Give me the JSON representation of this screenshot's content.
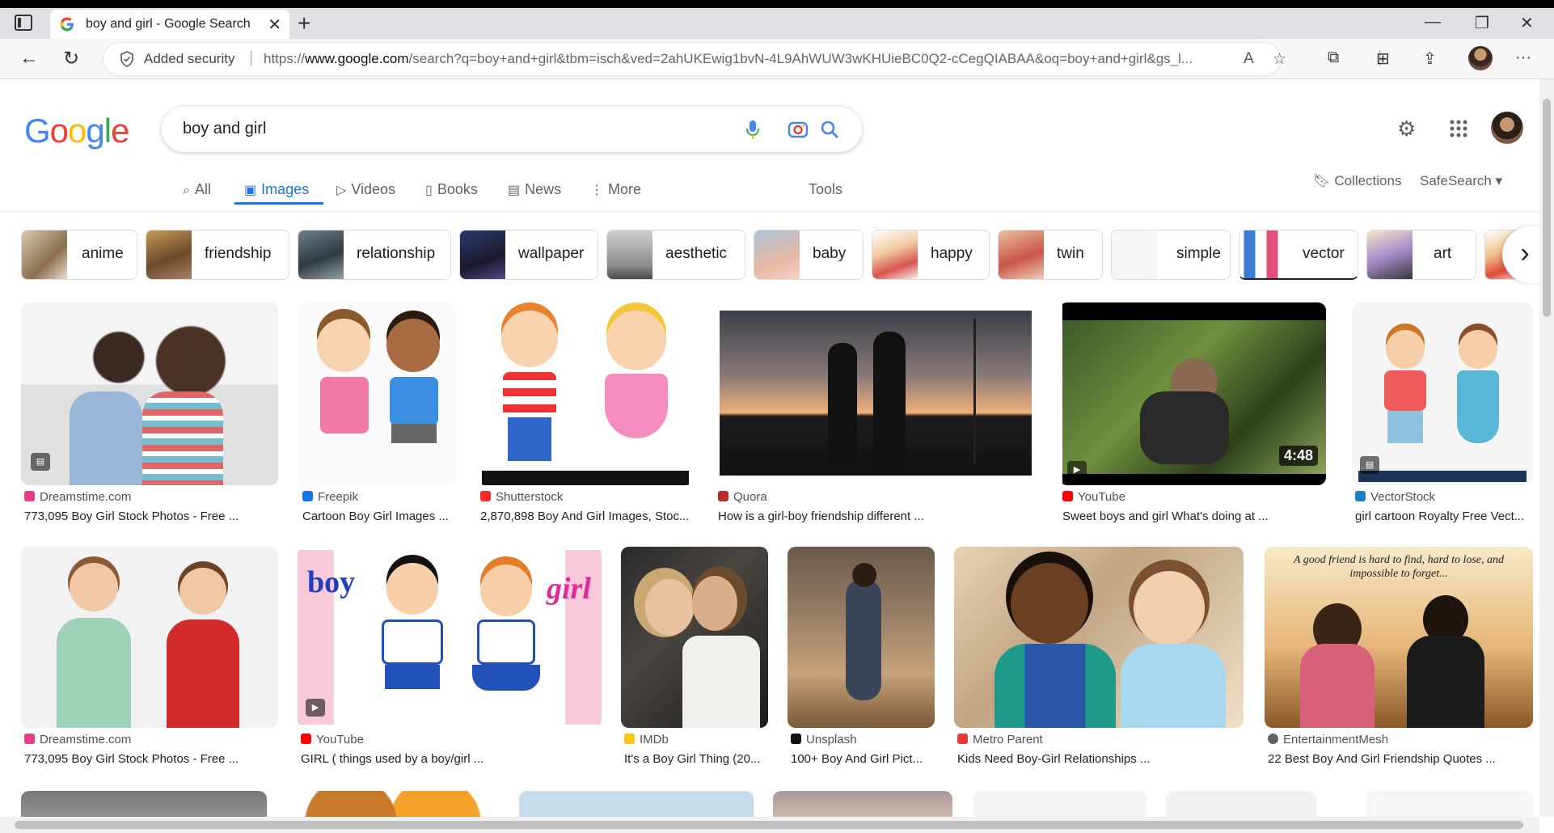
{
  "browser": {
    "tab_title": "boy and girl - Google Search",
    "security_label": "Added security",
    "url_prefix": "https://",
    "url_host": "www.google.com",
    "url_rest": "/search?q=boy+and+girl&tbm=isch&ved=2ahUKEwig1bvN-4L9AhWUW3wKHUieBC0Q2-cCegQIABAA&oq=boy+and+girl&gs_l..."
  },
  "search": {
    "query": "boy and girl"
  },
  "navtabs": [
    {
      "label": "All",
      "icon": "search-icon"
    },
    {
      "label": "Images",
      "icon": "image-icon"
    },
    {
      "label": "Videos",
      "icon": "play-icon"
    },
    {
      "label": "Books",
      "icon": "book-icon"
    },
    {
      "label": "News",
      "icon": "news-icon"
    },
    {
      "label": "More",
      "icon": "more-vert-icon"
    }
  ],
  "tools_label": "Tools",
  "collections_label": "Collections",
  "safesearch_label": "SafeSearch",
  "chips": [
    "anime",
    "friendship",
    "relationship",
    "wallpaper",
    "aesthetic",
    "baby",
    "happy",
    "twin",
    "simple",
    "vector",
    "art"
  ],
  "results_row1": [
    {
      "source": "Dreamstime.com",
      "caption": "773,095 Boy Girl Stock Photos - Free ...",
      "fav_color": "#e33d8c"
    },
    {
      "source": "Freepik",
      "caption": "Cartoon Boy Girl Images ...",
      "fav_color": "#1273eb"
    },
    {
      "source": "Shutterstock",
      "caption": "2,870,898 Boy And Girl Images, Stoc...",
      "fav_color": "#ee2b24"
    },
    {
      "source": "Quora",
      "caption": "How is a girl-boy friendship different ...",
      "fav_color": "#b92b27"
    },
    {
      "source": "YouTube",
      "caption": "Sweet boys and girl What's doing at ...",
      "fav_color": "#ff0000",
      "duration": "4:48"
    },
    {
      "source": "VectorStock",
      "caption": "girl cartoon Royalty Free Vect...",
      "fav_color": "#1d7fc1"
    }
  ],
  "results_row2": [
    {
      "source": "Dreamstime.com",
      "caption": "773,095 Boy Girl Stock Photos - Free ...",
      "fav_color": "#e33d8c"
    },
    {
      "source": "YouTube",
      "caption": "GIRL ( things used by a boy/girl ...",
      "fav_color": "#ff0000"
    },
    {
      "source": "IMDb",
      "caption": "It's a Boy Girl Thing (20...",
      "fav_color": "#f5c518"
    },
    {
      "source": "Unsplash",
      "caption": "100+ Boy And Girl Pict...",
      "fav_color": "#111111"
    },
    {
      "source": "Metro Parent",
      "caption": "Kids Need Boy-Girl Relationships ...",
      "fav_color": "#e53935"
    },
    {
      "source": "EntertainmentMesh",
      "caption": "22 Best Boy And Girl Friendship Quotes ...",
      "fav_color": "#5f6368"
    }
  ],
  "image_texts": {
    "boy": "boy",
    "girl": "girl",
    "quote": "A good friend is hard to find, hard to lose, and impossible to forget..."
  }
}
